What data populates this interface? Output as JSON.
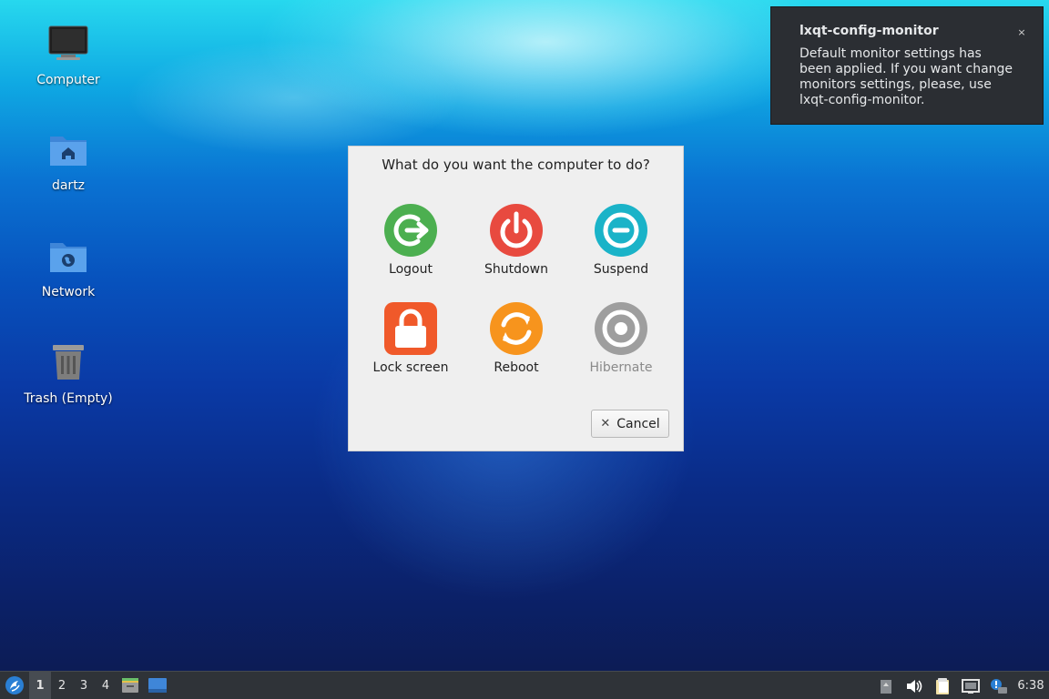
{
  "desktop": {
    "icons": [
      {
        "label": "Computer",
        "icon": "computer-icon"
      },
      {
        "label": "dartz",
        "icon": "home-folder-icon"
      },
      {
        "label": "Network",
        "icon": "network-folder-icon"
      },
      {
        "label": "Trash (Empty)",
        "icon": "trash-icon"
      }
    ]
  },
  "notification": {
    "title": "lxqt-config-monitor",
    "body": "Default monitor settings has been applied. If you want change monitors settings, please, use lxqt-config-monitor.",
    "close_glyph": "×"
  },
  "dialog": {
    "question": "What do you want the computer to do?",
    "actions": [
      {
        "label": "Logout",
        "icon": "logout-icon",
        "color": "#4caf50",
        "enabled": true
      },
      {
        "label": "Shutdown",
        "icon": "power-icon",
        "color": "#e84a3f",
        "enabled": true
      },
      {
        "label": "Suspend",
        "icon": "suspend-icon",
        "color": "#1ab3c8",
        "enabled": true
      },
      {
        "label": "Lock screen",
        "icon": "lock-icon",
        "color": "#f0592a",
        "enabled": true
      },
      {
        "label": "Reboot",
        "icon": "reboot-icon",
        "color": "#f7941d",
        "enabled": true
      },
      {
        "label": "Hibernate",
        "icon": "hibernate-icon",
        "color": "#9e9e9e",
        "enabled": false
      }
    ],
    "cancel": {
      "label": "Cancel",
      "glyph": "✕"
    }
  },
  "taskbar": {
    "start_icon": "lxqt-menu-icon",
    "desktops": [
      "1",
      "2",
      "3",
      "4"
    ],
    "active_desktop": "1",
    "launchers": [
      "file-manager-icon",
      "show-desktop-icon"
    ],
    "tray": [
      "battery-icon",
      "volume-icon",
      "clipboard-icon",
      "network-icon",
      "update-notifier-icon"
    ],
    "clock": "6:38"
  }
}
